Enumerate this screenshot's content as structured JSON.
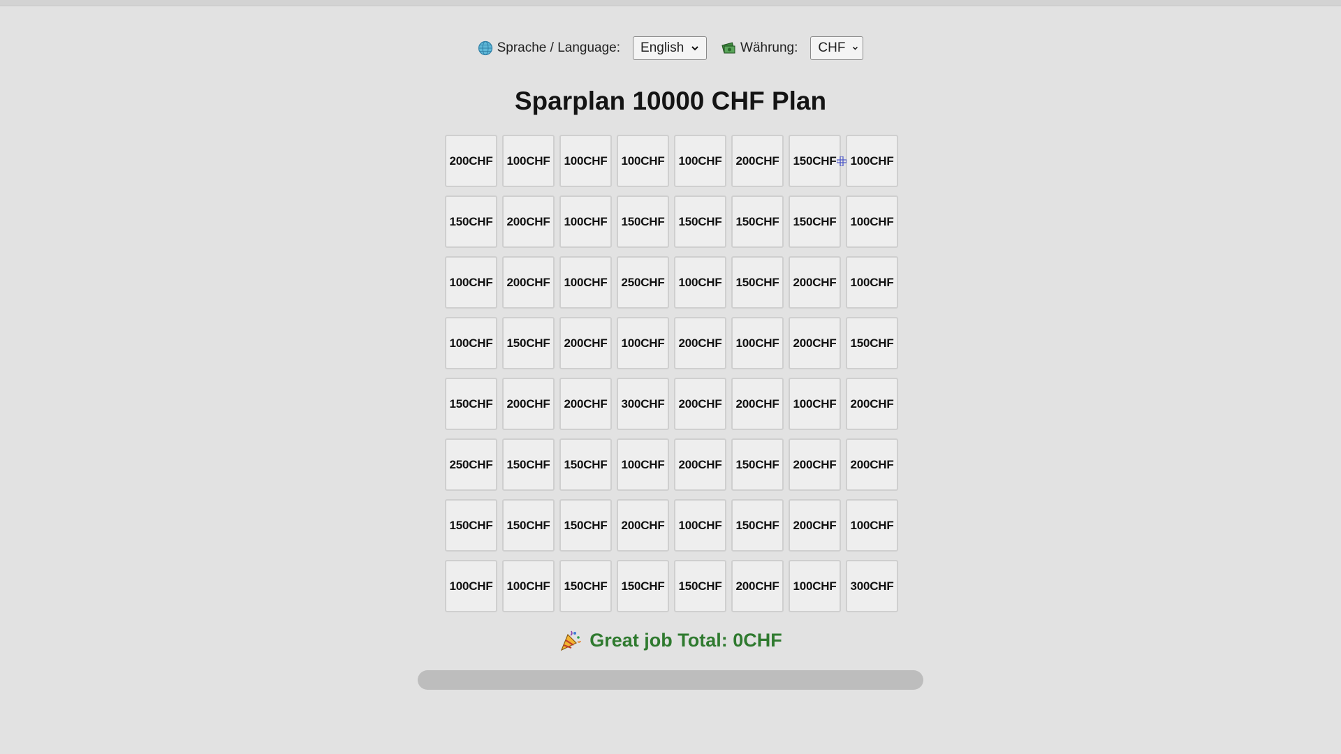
{
  "controls": {
    "language_label": "Sprache / Language:",
    "language_value": "English",
    "currency_label": "Währung:",
    "currency_value": "CHF"
  },
  "title": "Sparplan 10000 CHF Plan",
  "grid": {
    "rows": [
      [
        "200CHF",
        "100CHF",
        "100CHF",
        "100CHF",
        "100CHF",
        "200CHF",
        "150CHF",
        "100CHF"
      ],
      [
        "150CHF",
        "200CHF",
        "100CHF",
        "150CHF",
        "150CHF",
        "150CHF",
        "150CHF",
        "100CHF"
      ],
      [
        "100CHF",
        "200CHF",
        "100CHF",
        "250CHF",
        "100CHF",
        "150CHF",
        "200CHF",
        "100CHF"
      ],
      [
        "100CHF",
        "150CHF",
        "200CHF",
        "100CHF",
        "200CHF",
        "100CHF",
        "200CHF",
        "150CHF"
      ],
      [
        "150CHF",
        "200CHF",
        "200CHF",
        "300CHF",
        "200CHF",
        "200CHF",
        "100CHF",
        "200CHF"
      ],
      [
        "250CHF",
        "150CHF",
        "150CHF",
        "100CHF",
        "200CHF",
        "150CHF",
        "200CHF",
        "200CHF"
      ],
      [
        "150CHF",
        "150CHF",
        "150CHF",
        "200CHF",
        "100CHF",
        "150CHF",
        "200CHF",
        "100CHF"
      ],
      [
        "100CHF",
        "100CHF",
        "150CHF",
        "150CHF",
        "150CHF",
        "200CHF",
        "100CHF",
        "300CHF"
      ]
    ]
  },
  "status": {
    "text": "Great job Total: 0CHF",
    "icon": "party-popper-icon"
  },
  "progress": {
    "fraction": 0
  },
  "colors": {
    "background": "#e2e2e2",
    "status_text": "#2f7a2f",
    "progress_track": "#bdbdbd"
  }
}
